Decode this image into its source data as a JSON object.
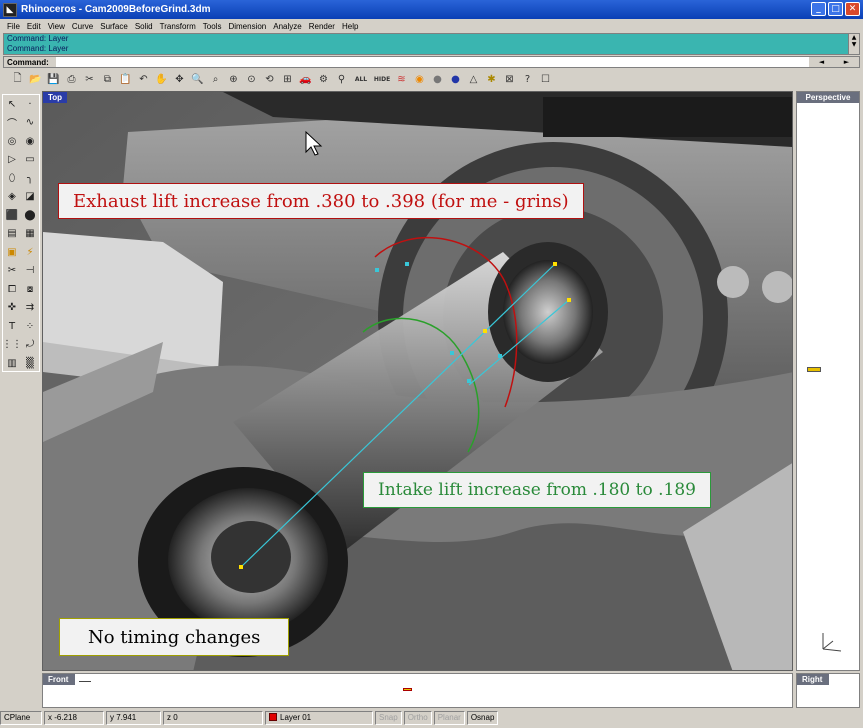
{
  "window": {
    "title": "Rhinoceros - Cam2009BeforeGrind.3dm"
  },
  "menu": [
    "File",
    "Edit",
    "View",
    "Curve",
    "Surface",
    "Solid",
    "Transform",
    "Tools",
    "Dimension",
    "Analyze",
    "Render",
    "Help"
  ],
  "command": {
    "history": [
      "Command: Layer",
      "Command: Layer"
    ],
    "prompt": "Command:",
    "value": ""
  },
  "toolbar": {
    "all_label": "ALL",
    "hide_label": "HIDE"
  },
  "viewports": {
    "top": {
      "label": "Top"
    },
    "perspective": {
      "label": "Perspective"
    },
    "front": {
      "label": "Front"
    },
    "right": {
      "label": "Right"
    }
  },
  "callouts": {
    "exhaust": "Exhaust lift increase from .380 to .398 (for me - grins)",
    "intake": "Intake lift increase from .180 to .189",
    "timing": "No timing changes"
  },
  "status": {
    "cplane": "CPlane",
    "x": "x -6.218",
    "y": "y 7.941",
    "z": "z 0",
    "layer": "Layer 01",
    "snap": "Snap",
    "ortho": "Ortho",
    "planar": "Planar",
    "osnap": "Osnap"
  },
  "colors": {
    "titlebar": "#0a3fb5",
    "command_history": "#3ab5b0",
    "exhaust_line": "#c01010",
    "intake_line": "#2aa02a",
    "axis_line": "#39c7d8",
    "layer_color": "#e00000"
  }
}
